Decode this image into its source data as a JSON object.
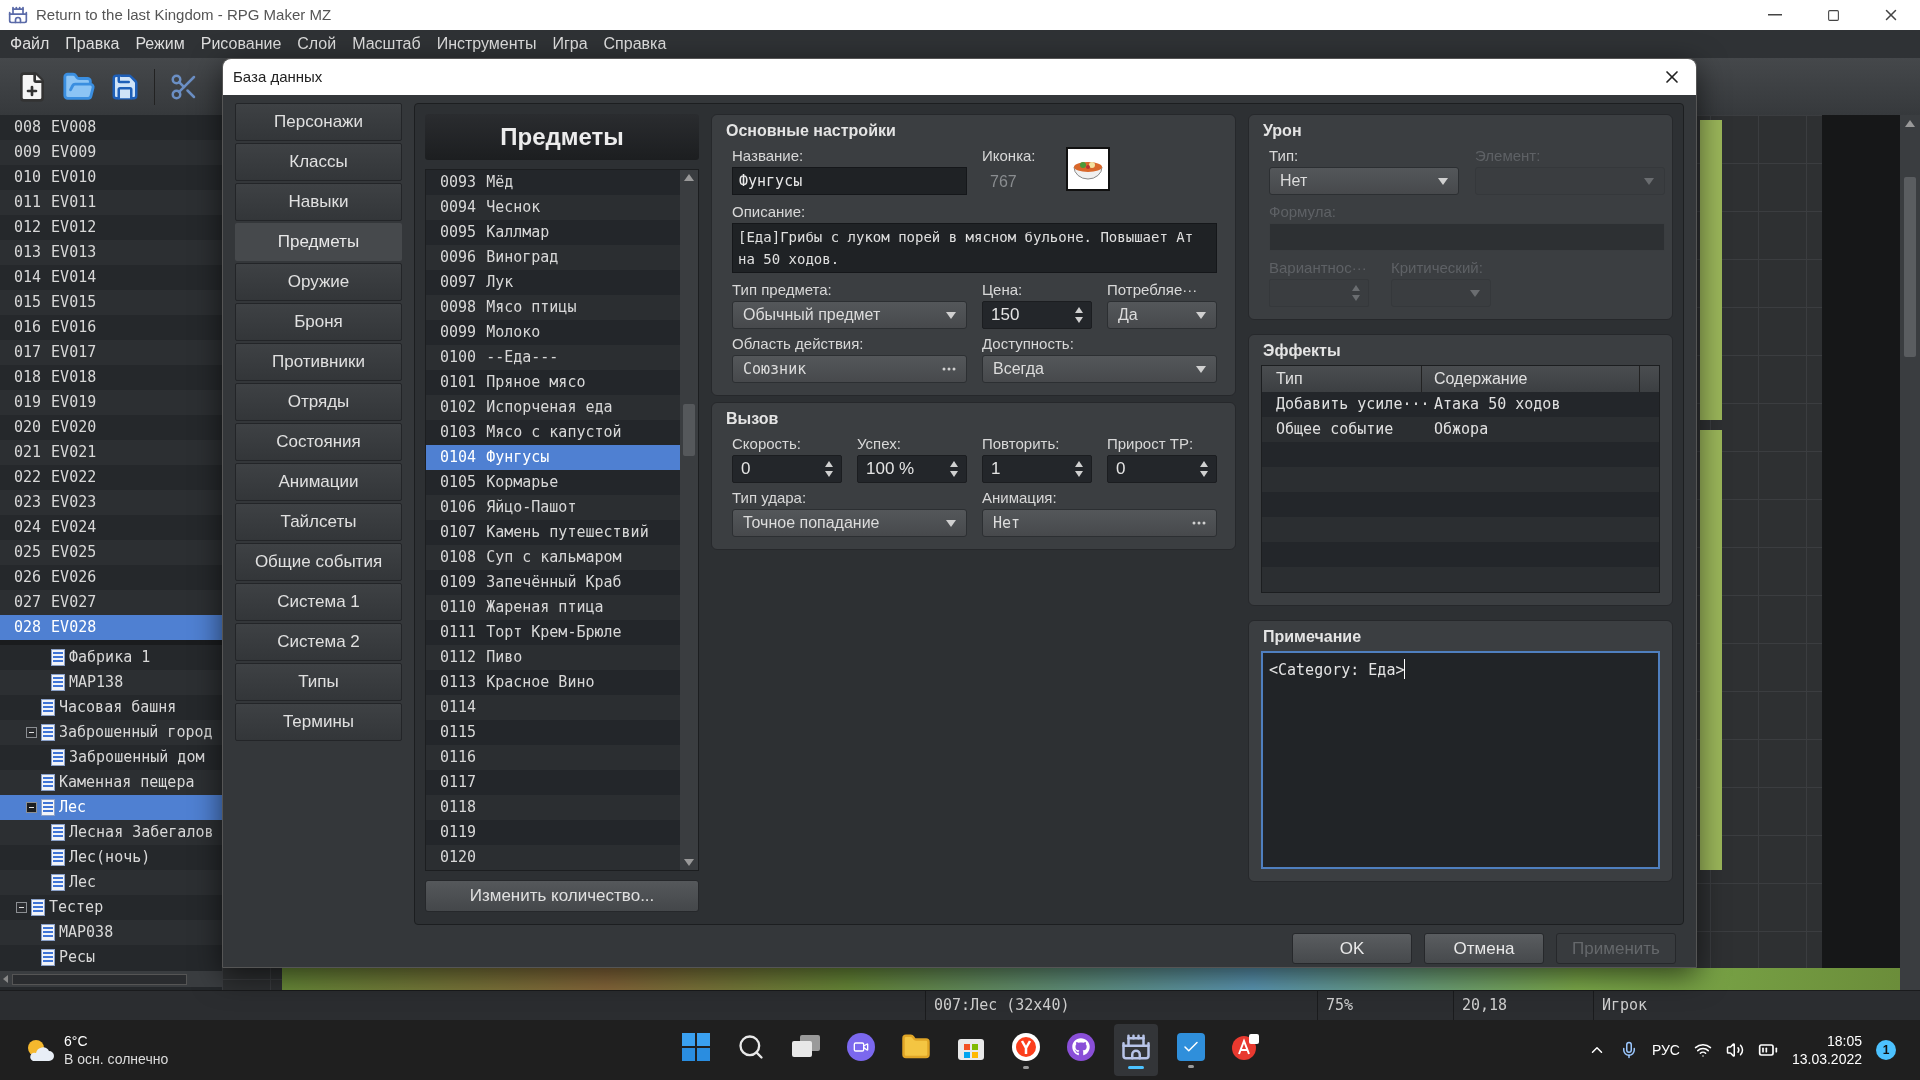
{
  "window": {
    "title": "Return to the last Kingdom - RPG Maker MZ"
  },
  "menu": [
    "Файл",
    "Правка",
    "Режим",
    "Рисование",
    "Слой",
    "Масштаб",
    "Инструменты",
    "Игра",
    "Справка"
  ],
  "events": [
    {
      "number": "008",
      "name": "EV008",
      "selected": false
    },
    {
      "number": "009",
      "name": "EV009",
      "selected": false
    },
    {
      "number": "010",
      "name": "EV010",
      "selected": false
    },
    {
      "number": "011",
      "name": "EV011",
      "selected": false
    },
    {
      "number": "012",
      "name": "EV012",
      "selected": false
    },
    {
      "number": "013",
      "name": "EV013",
      "selected": false
    },
    {
      "number": "014",
      "name": "EV014",
      "selected": false
    },
    {
      "number": "015",
      "name": "EV015",
      "selected": false
    },
    {
      "number": "016",
      "name": "EV016",
      "selected": false
    },
    {
      "number": "017",
      "name": "EV017",
      "selected": false
    },
    {
      "number": "018",
      "name": "EV018",
      "selected": false
    },
    {
      "number": "019",
      "name": "EV019",
      "selected": false
    },
    {
      "number": "020",
      "name": "EV020",
      "selected": false
    },
    {
      "number": "021",
      "name": "EV021",
      "selected": false
    },
    {
      "number": "022",
      "name": "EV022",
      "selected": false
    },
    {
      "number": "023",
      "name": "EV023",
      "selected": false
    },
    {
      "number": "024",
      "name": "EV024",
      "selected": false
    },
    {
      "number": "025",
      "name": "EV025",
      "selected": false
    },
    {
      "number": "026",
      "name": "EV026",
      "selected": false
    },
    {
      "number": "027",
      "name": "EV027",
      "selected": false
    },
    {
      "number": "028",
      "name": "EV028",
      "selected": true
    }
  ],
  "map_tree": [
    {
      "children": [
        {
          "children": [
            {
              "label": "Фабрика 1",
              "selected": false
            },
            {
              "label": "MAP138",
              "selected": false
            }
          ]
        },
        {
          "label": "Часовая башня",
          "selected": false
        },
        {
          "label": "Заброшенный город",
          "selected": false,
          "expanded": true,
          "children": [
            {
              "label": "Заброшенный дом",
              "selected": false
            }
          ]
        },
        {
          "label": "Каменная пещера",
          "selected": false
        },
        {
          "label": "Лес",
          "selected": true,
          "expanded": true,
          "children": [
            {
              "label": "Лесная Забегалов",
              "selected": false
            },
            {
              "label": "Лес(ночь)",
              "selected": false
            },
            {
              "label": "Лес",
              "selected": false
            }
          ]
        }
      ]
    },
    {
      "label": "Тестер",
      "selected": false,
      "expanded": true,
      "children": [
        {
          "label": "MAP038",
          "selected": false
        },
        {
          "label": "Ресы",
          "selected": false
        }
      ]
    }
  ],
  "status_bar": [
    "007:Лес (32x40)",
    "75%",
    "20,18",
    "Игрок"
  ],
  "dialog": {
    "title": "База данных",
    "categories": [
      {
        "label": "Персонажи",
        "selected": false
      },
      {
        "label": "Классы",
        "selected": false
      },
      {
        "label": "Навыки",
        "selected": false
      },
      {
        "label": "Предметы",
        "selected": true
      },
      {
        "label": "Оружие",
        "selected": false
      },
      {
        "label": "Броня",
        "selected": false
      },
      {
        "label": "Противники",
        "selected": false
      },
      {
        "label": "Отряды",
        "selected": false
      },
      {
        "label": "Состояния",
        "selected": false
      },
      {
        "label": "Анимации",
        "selected": false
      },
      {
        "label": "Тайлсеты",
        "selected": false
      },
      {
        "label": "Общие события",
        "selected": false
      },
      {
        "label": "Система 1",
        "selected": false
      },
      {
        "label": "Система 2",
        "selected": false
      },
      {
        "label": "Типы",
        "selected": false
      },
      {
        "label": "Термины",
        "selected": false
      }
    ],
    "list_title": "Предметы",
    "items": [
      {
        "number": "0093",
        "name": "Мёд",
        "selected": false
      },
      {
        "number": "0094",
        "name": "Чеснок",
        "selected": false
      },
      {
        "number": "0095",
        "name": "Каллмар",
        "selected": false
      },
      {
        "number": "0096",
        "name": "Виноград",
        "selected": false
      },
      {
        "number": "0097",
        "name": "Лук",
        "selected": false
      },
      {
        "number": "0098",
        "name": "Мясо птицы",
        "selected": false
      },
      {
        "number": "0099",
        "name": "Молоко",
        "selected": false
      },
      {
        "number": "0100",
        "name": "--Еда---",
        "selected": false
      },
      {
        "number": "0101",
        "name": "Пряное мясо",
        "selected": false
      },
      {
        "number": "0102",
        "name": "Испорченая еда",
        "selected": false
      },
      {
        "number": "0103",
        "name": "Мясо с капустой",
        "selected": false
      },
      {
        "number": "0104",
        "name": "Фунгусы",
        "selected": true
      },
      {
        "number": "0105",
        "name": "Кормарье",
        "selected": false
      },
      {
        "number": "0106",
        "name": "Яйцо-Пашот",
        "selected": false
      },
      {
        "number": "0107",
        "name": "Камень путешествий",
        "selected": false
      },
      {
        "number": "0108",
        "name": "Суп с кальмаром",
        "selected": false
      },
      {
        "number": "0109",
        "name": "Запечённый Краб",
        "selected": false
      },
      {
        "number": "0110",
        "name": "Жареная птица",
        "selected": false
      },
      {
        "number": "0111",
        "name": "Торт Крем-Брюле",
        "selected": false
      },
      {
        "number": "0112",
        "name": "Пиво",
        "selected": false
      },
      {
        "number": "0113",
        "name": "Красное Вино",
        "selected": false
      },
      {
        "number": "0114",
        "selected": false
      },
      {
        "number": "0115",
        "selected": false
      },
      {
        "number": "0116",
        "selected": false
      },
      {
        "number": "0117",
        "selected": false
      },
      {
        "number": "0118",
        "selected": false
      },
      {
        "number": "0119",
        "selected": false
      },
      {
        "number": "0120",
        "selected": false
      }
    ],
    "change_count_button": "Изменить количество...",
    "general": {
      "title": "Основные настройки",
      "name": {
        "label": "Название:",
        "value": "Фунгусы"
      },
      "icon": {
        "label": "Иконка:",
        "index": "767"
      },
      "description": {
        "label": "Описание:",
        "value": "[Еда]Грибы с луком порей в мясном бульоне. Повышает Ат на 50 ходов."
      },
      "item_type": {
        "label": "Тип предмета:",
        "value": "Обычный предмет"
      },
      "price": {
        "label": "Цена:",
        "value": "150"
      },
      "consumable": {
        "label": "Потребляе···",
        "value": "Да"
      },
      "scope": {
        "label": "Область действия:",
        "value": "Союзник"
      },
      "occasion": {
        "label": "Доступность:",
        "value": "Всегда"
      }
    },
    "invocation": {
      "title": "Вызов",
      "speed": {
        "label": "Скорость:",
        "value": "0"
      },
      "success": {
        "label": "Успех:",
        "value": "100 %"
      },
      "repeat": {
        "label": "Повторить:",
        "value": "1"
      },
      "tp_gain": {
        "label": "Прирост TP:",
        "value": "0"
      },
      "hit_type": {
        "label": "Тип удара:",
        "value": "Точное попадание"
      },
      "animation": {
        "label": "Анимация:",
        "value": "Нет"
      }
    },
    "damage": {
      "title": "Урон",
      "type": {
        "label": "Тип:",
        "value": "Нет",
        "disabled": false
      },
      "element": {
        "label": "Элемент:",
        "disabled": true
      },
      "formula": {
        "label": "Формула:",
        "disabled": true
      },
      "variance": {
        "label": "Вариантнос···",
        "disabled": true
      },
      "critical": {
        "label": "Критический:",
        "disabled": true
      }
    },
    "effects": {
      "title": "Эффекты",
      "columns": [
        "Тип",
        "Содержание"
      ],
      "rows": [
        {
          "type": "Добавить усиле···",
          "content": "Атака 50 ходов"
        },
        {
          "type": "Общее событие",
          "content": "Обжора"
        }
      ]
    },
    "note": {
      "title": "Примечание",
      "value": "<Category: Еда>"
    },
    "buttons": [
      {
        "label": "OK",
        "disabled": false
      },
      {
        "label": "Отмена",
        "disabled": false
      },
      {
        "label": "Применить",
        "disabled": true
      }
    ]
  },
  "taskbar": {
    "weather": {
      "temperature": "6°C",
      "condition": "В осн. солнечно"
    },
    "apps": [
      {
        "kind": "start",
        "running": false,
        "active": false
      },
      {
        "kind": "search",
        "running": false,
        "active": false
      },
      {
        "kind": "taskview",
        "running": false,
        "active": false
      },
      {
        "kind": "chat",
        "running": false,
        "active": false
      },
      {
        "kind": "explorer",
        "running": false,
        "active": false
      },
      {
        "kind": "store",
        "running": false,
        "active": false
      },
      {
        "kind": "browser",
        "running": true,
        "active": false
      },
      {
        "kind": "github",
        "running": false,
        "active": false
      },
      {
        "kind": "game",
        "running": true,
        "active": true
      },
      {
        "kind": "editor",
        "running": true,
        "active": false
      },
      {
        "kind": "translator",
        "running": false,
        "active": false
      }
    ],
    "language": "РУС",
    "time": "18:05",
    "date": "13.03.2022",
    "notifications": "1"
  }
}
